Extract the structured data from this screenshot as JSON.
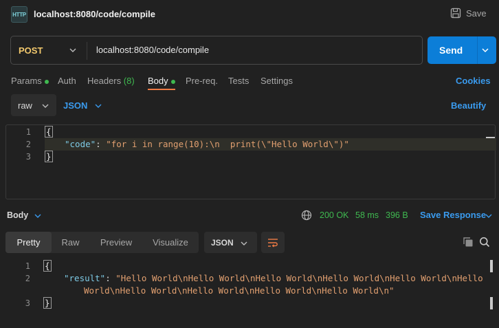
{
  "header": {
    "icon_text": "HTTP",
    "title": "localhost:8080/code/compile",
    "save_label": "Save"
  },
  "request": {
    "method": "POST",
    "url": "localhost:8080/code/compile",
    "send_label": "Send"
  },
  "tabs": {
    "params": "Params",
    "auth": "Auth",
    "headers": "Headers",
    "headers_count": "(8)",
    "body": "Body",
    "prereq": "Pre-req.",
    "tests": "Tests",
    "settings": "Settings",
    "cookies": "Cookies",
    "active": "Body"
  },
  "body_options": {
    "mode": "raw",
    "language": "JSON",
    "beautify": "Beautify"
  },
  "request_editor": {
    "line_numbers": [
      "1",
      "2",
      "3"
    ],
    "open_brace": "{",
    "key": "\"code\"",
    "colon": ": ",
    "value": "\"for i in range(10):\\n  print(\\\"Hello World\\\")\"",
    "close_brace": "}"
  },
  "response": {
    "section_label": "Body",
    "status": "200 OK",
    "time": "58 ms",
    "size": "396 B",
    "save_response": "Save Response",
    "views": [
      "Pretty",
      "Raw",
      "Preview",
      "Visualize"
    ],
    "active_view": "Pretty",
    "format": "JSON",
    "icons": [
      "globe-icon",
      "wrap-lines-icon",
      "copy-icon",
      "search-icon"
    ]
  },
  "response_editor": {
    "line_numbers": [
      "1",
      "2",
      "3"
    ],
    "open_brace": "{",
    "key": "\"result\"",
    "colon": ": ",
    "value_line1": "\"Hello World\\nHello World\\nHello World\\nHello World\\nHello World\\nHello",
    "value_line2": "World\\nHello World\\nHello World\\nHello World\\nHello World\\n\"",
    "close_brace": "}"
  },
  "colors": {
    "background": "#212121",
    "accent_blue": "#0c7ed8",
    "link_blue": "#3a9bef",
    "method_yellow": "#f3c96d",
    "success_green": "#3fb950",
    "tab_underline": "#ef7b45",
    "json_key": "#7ecbe6",
    "json_string": "#e2a070"
  }
}
